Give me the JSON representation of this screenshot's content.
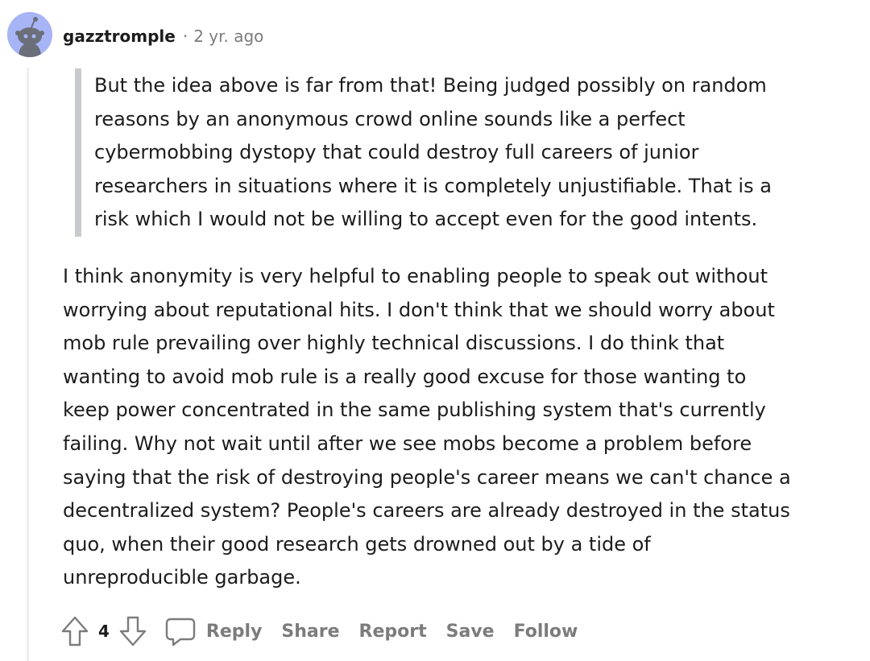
{
  "comment": {
    "username": "gazztromple",
    "separator": "·",
    "timestamp": "2 yr. ago",
    "quote": "But the idea above is far from that! Being judged possibly on random\nreasons by an anonymous crowd online sounds like a perfect\ncybermobbing dystopy that could destroy full careers of junior\nresearchers in situations where it is completely unjustifiable. That is a\nrisk which I would not be willing to accept even for the good intents.",
    "body": "I think anonymity is very helpful to enabling people to speak out without\nworrying about reputational hits. I don't think that we should worry about\nmob rule prevailing over highly technical discussions. I do think that\nwanting to avoid mob rule is a really good excuse for those wanting to\nkeep power concentrated in the same publishing system that's currently\nfailing. Why not wait until after we see mobs become a problem before\nsaying that the risk of destroying people's career means we can't chance a\ndecentralized system? People's careers are already destroyed in the status\nquo, when their good research gets drowned out by a tide of\nunreproducible garbage.",
    "vote_count": "4"
  },
  "actions": {
    "reply": "Reply",
    "share": "Share",
    "report": "Report",
    "save": "Save",
    "follow": "Follow"
  },
  "icons": {
    "avatar": "snoo-avatar-icon",
    "upvote": "upvote-arrow-icon",
    "downvote": "downvote-arrow-icon",
    "reply": "comment-bubble-icon"
  },
  "colors": {
    "avatar_bg": "#a7b4f5",
    "text": "#1c1c1c",
    "muted": "#7c7c7c",
    "quote_bar": "#c8cbcd",
    "thread_line": "#edeff1"
  }
}
